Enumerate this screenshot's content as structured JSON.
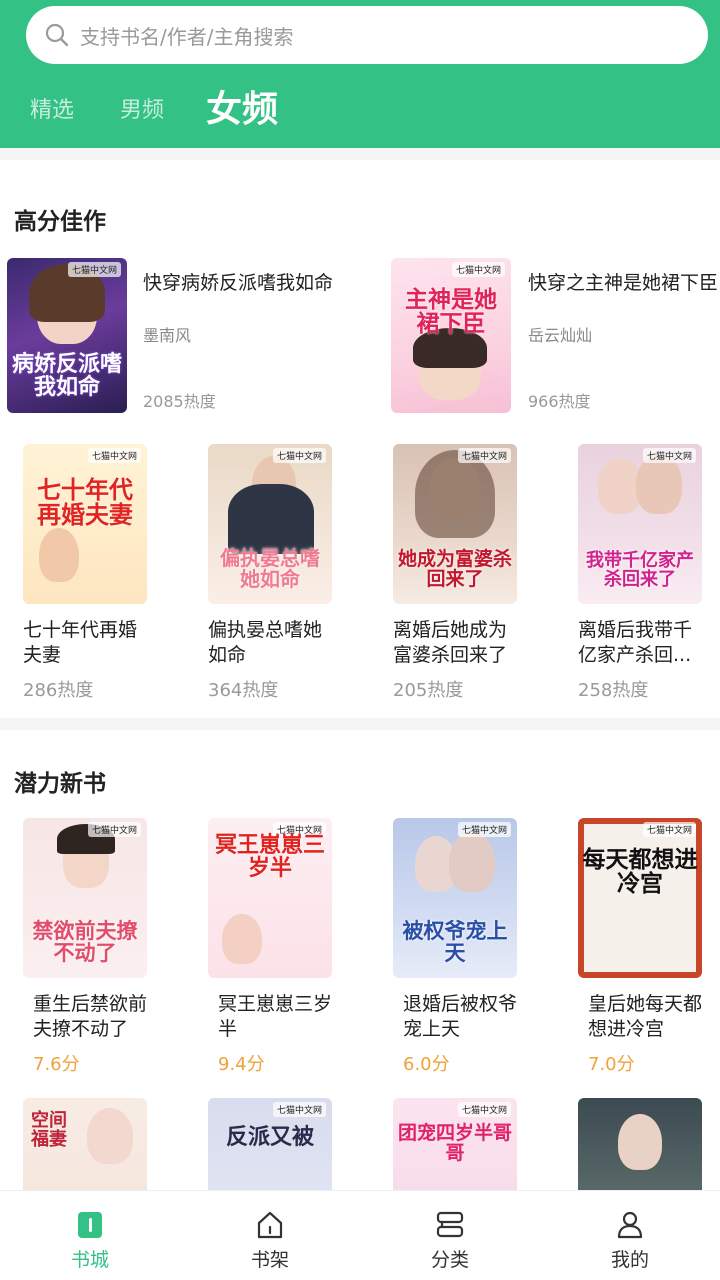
{
  "search": {
    "placeholder": "支持书名/作者/主角搜索"
  },
  "tabs": [
    {
      "label": "精选",
      "active": false
    },
    {
      "label": "男频",
      "active": false
    },
    {
      "label": "女频",
      "active": true
    }
  ],
  "colors": {
    "accent": "#33c185",
    "score": "#f0a23a"
  },
  "sections": {
    "high": {
      "title": "高分佳作",
      "featured": [
        {
          "title": "快穿病娇反派嗜我如命",
          "author": "墨南风",
          "heat": "2085热度",
          "cover_text": "病娇反派嗜我如命",
          "cover_logo": "七猫中文网"
        },
        {
          "title": "快穿之主神是她裙下臣",
          "author": "岳云灿灿",
          "heat": "966热度",
          "cover_text": "主神是她裙下臣",
          "cover_logo": "七猫中文网"
        }
      ],
      "books": [
        {
          "title": "七十年代再婚夫妻",
          "heat": "286热度",
          "cover_text": "七十年代再婚夫妻",
          "cover_logo": "七猫中文网"
        },
        {
          "title": "偏执晏总嗜她如命",
          "heat": "364热度",
          "cover_text": "偏执晏总嗜她如命",
          "cover_logo": "七猫中文网"
        },
        {
          "title": "离婚后她成为富婆杀回来了",
          "heat": "205热度",
          "cover_text": "她成为富婆杀回来了",
          "cover_logo": "七猫中文网"
        },
        {
          "title": "离婚后我带千亿家产杀回...",
          "heat": "258热度",
          "cover_text": "我带千亿家产杀回来了",
          "cover_logo": "七猫中文网"
        }
      ]
    },
    "new": {
      "title": "潜力新书",
      "books": [
        {
          "title": "重生后禁欲前夫撩不动了",
          "score": "7.6分",
          "cover_text": "禁欲前夫撩不动了",
          "cover_logo": "七猫中文网"
        },
        {
          "title": "冥王崽崽三岁半",
          "score": "9.4分",
          "cover_text": "冥王崽崽三岁半",
          "cover_logo": "七猫中文网"
        },
        {
          "title": "退婚后被权爷宠上天",
          "score": "6.0分",
          "cover_text": "被权爷宠上天",
          "cover_logo": "七猫中文网"
        },
        {
          "title": "皇后她每天都想进冷宫",
          "score": "7.0分",
          "cover_text": "每天都想进冷宫",
          "cover_logo": "七猫中文网"
        }
      ],
      "partial_covers": [
        {
          "cover_text": "空间福妻",
          "cover_logo": ""
        },
        {
          "cover_text": "反派又被",
          "cover_logo": "七猫中文网"
        },
        {
          "cover_text": "团宠四岁半哥哥",
          "cover_logo": "七猫中文网"
        },
        {
          "cover_text": "",
          "cover_logo": ""
        }
      ]
    }
  },
  "nav": [
    {
      "label": "书城",
      "icon": "book-city-icon",
      "active": true
    },
    {
      "label": "书架",
      "icon": "bookshelf-home-icon",
      "active": false
    },
    {
      "label": "分类",
      "icon": "category-icon",
      "active": false
    },
    {
      "label": "我的",
      "icon": "profile-icon",
      "active": false
    }
  ]
}
